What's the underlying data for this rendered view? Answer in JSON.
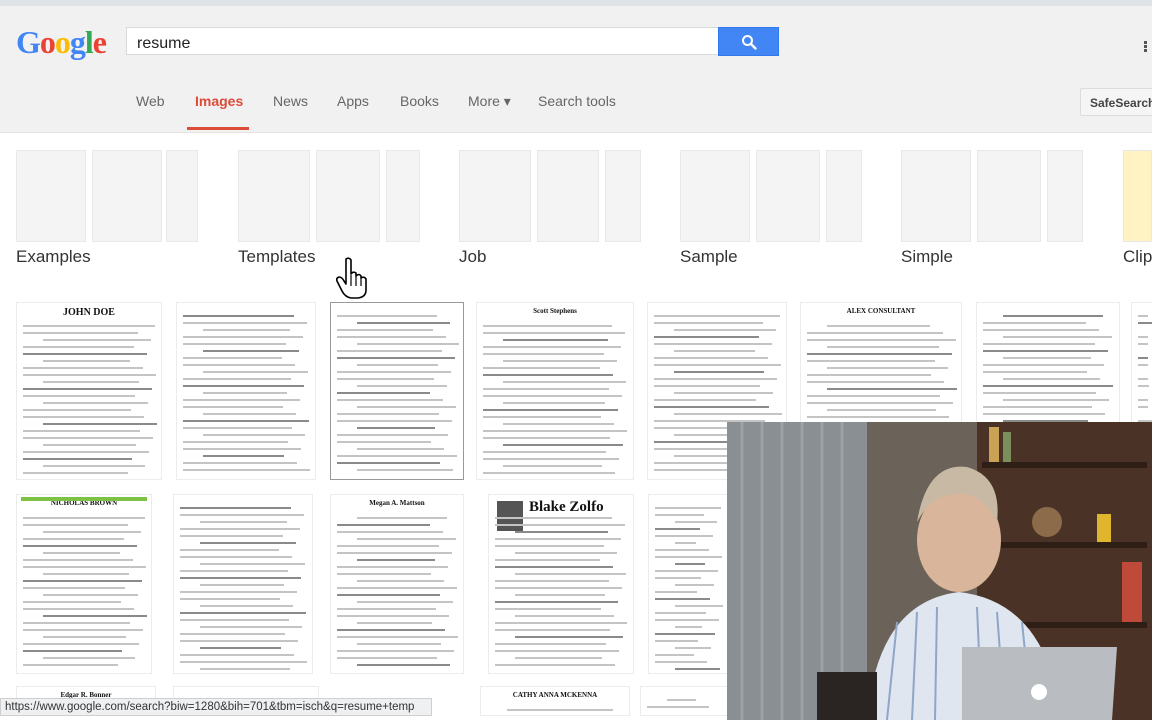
{
  "browser": {
    "status_url": "https://www.google.com/search?biw=1280&bih=701&tbm=isch&q=resume+temp"
  },
  "header": {
    "logo": [
      {
        "ch": "G",
        "color": "#4285f4"
      },
      {
        "ch": "o",
        "color": "#ea4335"
      },
      {
        "ch": "o",
        "color": "#fbbc05"
      },
      {
        "ch": "g",
        "color": "#4285f4"
      },
      {
        "ch": "l",
        "color": "#34a853"
      },
      {
        "ch": "e",
        "color": "#ea4335"
      }
    ],
    "query": "resume",
    "search_icon": "search-icon",
    "accent": "#4285f4"
  },
  "tabs": {
    "items": [
      {
        "label": "Web"
      },
      {
        "label": "Images",
        "active": true
      },
      {
        "label": "News"
      },
      {
        "label": "Apps"
      },
      {
        "label": "Books"
      },
      {
        "label": "More ▾"
      },
      {
        "label": "Search tools"
      }
    ],
    "safesearch": "SafeSearch",
    "active_color": "#dd4b39"
  },
  "categories": [
    {
      "label": "Examples"
    },
    {
      "label": "Templates"
    },
    {
      "label": "Job"
    },
    {
      "label": "Sample"
    },
    {
      "label": "Simple"
    },
    {
      "label": "Clip"
    }
  ],
  "results": {
    "row1_headings": [
      "JOHN DOE",
      "",
      "",
      "Scott Stephens",
      "",
      "ALEX CONSULTANT",
      ""
    ],
    "row2_headings": [
      "NICHOLAS BROWN",
      "",
      "Megan A. Mattson",
      "Blake Zolfo",
      ""
    ],
    "row3_headings": [
      "Edgar R. Bonner",
      "",
      "CATHY ANNA MCKENNA",
      ""
    ]
  },
  "video_overlay": {
    "description_icon": "presenter-video"
  }
}
